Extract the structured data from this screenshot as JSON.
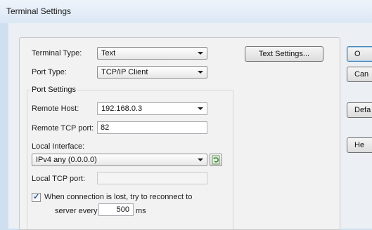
{
  "window": {
    "title": "Terminal Settings"
  },
  "terminal_type": {
    "label": "Terminal Type:",
    "value": "Text"
  },
  "port_type": {
    "label": "Port Type:",
    "value": "TCP/IP Client"
  },
  "buttons": {
    "text_settings": "Text Settings...",
    "ok": "O",
    "cancel": "Can",
    "defaults": "Defa",
    "help": "He"
  },
  "port_settings": {
    "title": "Port Settings",
    "remote_host": {
      "label": "Remote Host:",
      "value": "192.168.0.3"
    },
    "remote_tcp_port": {
      "label": "Remote TCP port:",
      "value": "82"
    },
    "local_interface": {
      "label": "Local Interface:",
      "value": "IPv4 any (0.0.0.0)"
    },
    "local_tcp_port": {
      "label": "Local TCP port:",
      "value": ""
    },
    "reconnect": {
      "checked": true,
      "label_line1": "When connection is lost, try to reconnect to",
      "label_line2": "server every",
      "interval_value": "500",
      "unit": "ms"
    }
  }
}
